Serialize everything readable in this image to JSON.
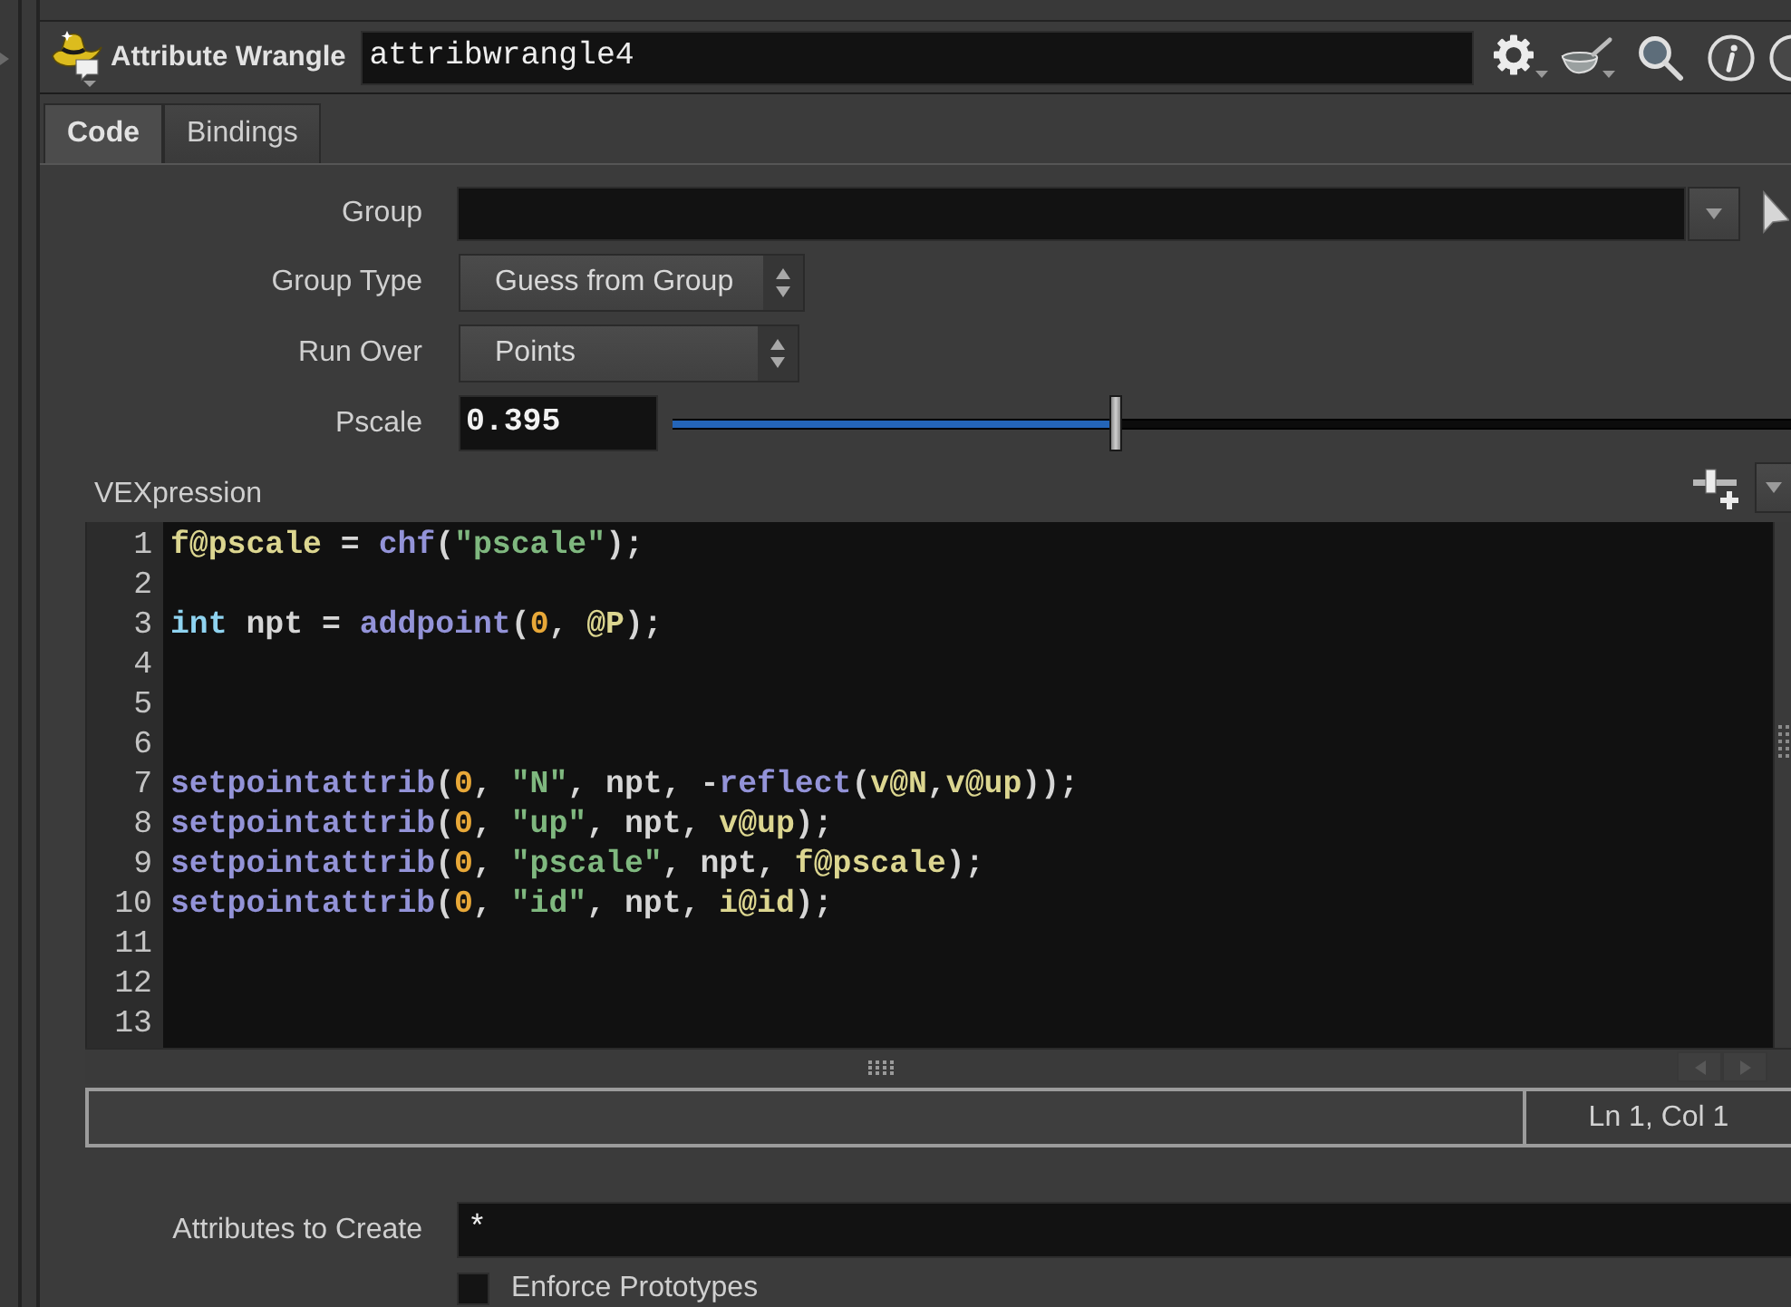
{
  "node": {
    "type": "Attribute Wrangle",
    "name": "attribwrangle4"
  },
  "tabs": [
    {
      "label": "Code",
      "selected": true
    },
    {
      "label": "Bindings",
      "selected": false
    }
  ],
  "parameters": [
    {
      "kind": "combo",
      "label": "Group"
    },
    {
      "kind": "menu",
      "label": "Group Type",
      "value": "Guess from Group"
    },
    {
      "kind": "menu",
      "label": "Run Over",
      "value": "Points"
    },
    {
      "kind": "slider",
      "label": "Pscale",
      "value": "0.395",
      "level": 0.395
    }
  ],
  "vexpression": {
    "label": "VEXpression",
    "lines": [
      {
        "number": "1",
        "tokens": [
          {
            "kind": "attribute",
            "text": "f@pscale"
          },
          {
            "kind": "plain",
            "text": " = "
          },
          {
            "kind": "function",
            "text": "chf"
          },
          {
            "kind": "plain",
            "text": "("
          },
          {
            "kind": "string",
            "text": "\"pscale\""
          },
          {
            "kind": "plain",
            "text": ");"
          }
        ]
      },
      {
        "number": "2"
      },
      {
        "number": "3",
        "tokens": [
          {
            "kind": "keyword",
            "text": "int"
          },
          {
            "kind": "plain",
            "text": " npt = "
          },
          {
            "kind": "function",
            "text": "addpoint"
          },
          {
            "kind": "plain",
            "text": "("
          },
          {
            "kind": "number",
            "text": "0"
          },
          {
            "kind": "plain",
            "text": ", "
          },
          {
            "kind": "attribute",
            "text": "@P"
          },
          {
            "kind": "plain",
            "text": ");"
          }
        ]
      },
      {
        "number": "4"
      },
      {
        "number": "5"
      },
      {
        "number": "6"
      },
      {
        "number": "7",
        "tokens": [
          {
            "kind": "function",
            "text": "setpointattrib"
          },
          {
            "kind": "plain",
            "text": "("
          },
          {
            "kind": "number",
            "text": "0"
          },
          {
            "kind": "plain",
            "text": ", "
          },
          {
            "kind": "string",
            "text": "\"N\""
          },
          {
            "kind": "plain",
            "text": ", npt, -"
          },
          {
            "kind": "function",
            "text": "reflect"
          },
          {
            "kind": "plain",
            "text": "("
          },
          {
            "kind": "attribute",
            "text": "v@N"
          },
          {
            "kind": "plain",
            "text": ","
          },
          {
            "kind": "attribute",
            "text": "v@up"
          },
          {
            "kind": "plain",
            "text": "));"
          }
        ]
      },
      {
        "number": "8",
        "tokens": [
          {
            "kind": "function",
            "text": "setpointattrib"
          },
          {
            "kind": "plain",
            "text": "("
          },
          {
            "kind": "number",
            "text": "0"
          },
          {
            "kind": "plain",
            "text": ", "
          },
          {
            "kind": "string",
            "text": "\"up\""
          },
          {
            "kind": "plain",
            "text": ", npt, "
          },
          {
            "kind": "attribute",
            "text": "v@up"
          },
          {
            "kind": "plain",
            "text": ");"
          }
        ]
      },
      {
        "number": "9",
        "tokens": [
          {
            "kind": "function",
            "text": "setpointattrib"
          },
          {
            "kind": "plain",
            "text": "("
          },
          {
            "kind": "number",
            "text": "0"
          },
          {
            "kind": "plain",
            "text": ", "
          },
          {
            "kind": "string",
            "text": "\"pscale\""
          },
          {
            "kind": "plain",
            "text": ", npt, "
          },
          {
            "kind": "attribute",
            "text": "f@pscale"
          },
          {
            "kind": "plain",
            "text": ");"
          }
        ]
      },
      {
        "number": "10",
        "tokens": [
          {
            "kind": "function",
            "text": "setpointattrib"
          },
          {
            "kind": "plain",
            "text": "("
          },
          {
            "kind": "number",
            "text": "0"
          },
          {
            "kind": "plain",
            "text": ", "
          },
          {
            "kind": "string",
            "text": "\"id\""
          },
          {
            "kind": "plain",
            "text": ", npt, "
          },
          {
            "kind": "attribute",
            "text": "i@id"
          },
          {
            "kind": "plain",
            "text": ");"
          }
        ]
      },
      {
        "number": "11"
      },
      {
        "number": "12"
      },
      {
        "number": "13"
      }
    ]
  },
  "status_bar": {
    "position": "Ln 1, Col 1"
  },
  "more_parameters": [
    {
      "kind": "text",
      "label": "Attributes to Create",
      "value": "*"
    },
    {
      "kind": "toggle",
      "label": "Enforce Prototypes",
      "checked": false
    }
  ]
}
